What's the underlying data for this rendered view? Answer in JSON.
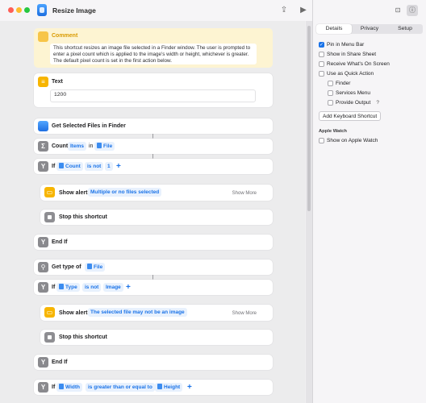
{
  "window": {
    "title": "Resize Image"
  },
  "comment": {
    "title": "Comment",
    "text": "This shortcut resizes an image file selected in a Finder window. The user is prompted to enter a pixel count which is applied to the image's width or height, whichever is greater. The default pixel count is set in the first action below."
  },
  "actions": {
    "text_label": "Text",
    "text_value": "1200",
    "get_files": "Get Selected Files in Finder",
    "count_label": "Count",
    "count_items": "Items",
    "count_in": "in",
    "count_file": "File",
    "if1_label": "If",
    "if1_var": "Count",
    "if1_op": "is not",
    "if1_val": "1",
    "alert1_label": "Show alert",
    "alert1_msg": "Multiple or no files selected",
    "alert1_more": "Show More",
    "stop1": "Stop this shortcut",
    "endif1": "End If",
    "gettype_label": "Get type of",
    "gettype_file": "File",
    "if2_label": "If",
    "if2_var": "Type",
    "if2_op": "is not",
    "if2_val": "Image",
    "alert2_label": "Show alert",
    "alert2_msg": "The selected file may not be an image",
    "alert2_more": "Show More",
    "stop2": "Stop this shortcut",
    "endif2": "End If",
    "if3_label": "If",
    "if3_var": "Width",
    "if3_op": "is greater than or equal to",
    "if3_val": "Height"
  },
  "sidebar": {
    "tabs": [
      "Details",
      "Privacy",
      "Setup"
    ],
    "active_tab": "Details",
    "options": {
      "pin_menu_bar": "Pin in Menu Bar",
      "share_sheet": "Show in Share Sheet",
      "receive_whats_on_screen": "Receive What's On Screen",
      "quick_action": "Use as Quick Action",
      "finder": "Finder",
      "services_menu": "Services Menu",
      "provide_output": "Provide Output",
      "help": "?"
    },
    "add_shortcut_button": "Add Keyboard Shortcut",
    "apple_watch_heading": "Apple Watch",
    "show_on_watch": "Show on Apple Watch"
  },
  "colors": {
    "accent": "#1a73e8",
    "comment_bg": "#fdf4d2",
    "comment_title": "#d99a00"
  }
}
